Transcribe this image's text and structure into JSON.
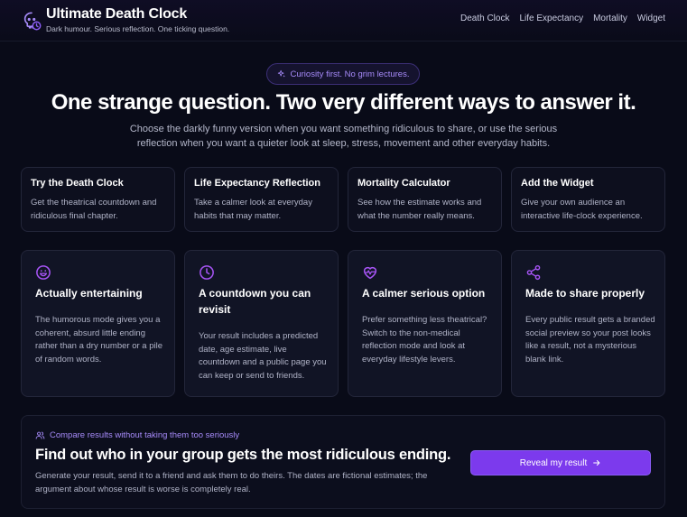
{
  "brand": {
    "title": "Ultimate Death Clock",
    "tagline": "Dark humour. Serious reflection. One ticking question."
  },
  "nav": [
    "Death Clock",
    "Life Expectancy",
    "Mortality",
    "Widget"
  ],
  "hero": {
    "badge": "Curiosity first. No grim lectures.",
    "title": "One strange question. Two very different ways to answer it.",
    "subtitle": "Choose the darkly funny version when you want something ridiculous to share, or use the serious reflection when you want a quieter look at sleep, stress, movement and other everyday habits."
  },
  "links": [
    {
      "title": "Try the Death Clock",
      "desc": "Get the theatrical countdown and ridiculous final chapter."
    },
    {
      "title": "Life Expectancy Reflection",
      "desc": "Take a calmer look at everyday habits that may matter."
    },
    {
      "title": "Mortality Calculator",
      "desc": "See how the estimate works and what the number really means."
    },
    {
      "title": "Add the Widget",
      "desc": "Give your own audience an interactive life-clock experience."
    }
  ],
  "features": [
    {
      "icon": "smile-icon",
      "title": "Actually entertaining",
      "desc": "The humorous mode gives you a coherent, absurd little ending rather than a dry number or a pile of random words."
    },
    {
      "icon": "clock-icon",
      "title": "A countdown you can revisit",
      "desc": "Your result includes a predicted date, age estimate, live countdown and a public page you can keep or send to friends."
    },
    {
      "icon": "heart-pulse-icon",
      "title": "A calmer serious option",
      "desc": "Prefer something less theatrical? Switch to the non-medical reflection mode and look at everyday lifestyle levers."
    },
    {
      "icon": "share-icon",
      "title": "Made to share properly",
      "desc": "Every public result gets a branded social preview so your post looks like a result, not a mysterious blank link."
    }
  ],
  "cta": {
    "eyebrow": "Compare results without taking them too seriously",
    "title": "Find out who in your group gets the most ridiculous ending.",
    "desc": "Generate your result, send it to a friend and ask them to do theirs. The dates are fictional estimates; the argument about whose result is worse is completely real.",
    "button": "Reveal my result"
  },
  "colors": {
    "accent": "#7c3aed",
    "accent_text": "#a78bfa",
    "background": "#090b18"
  }
}
